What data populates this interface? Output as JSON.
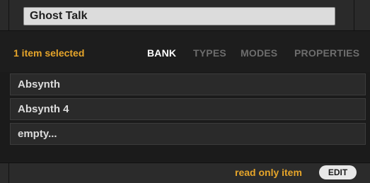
{
  "name_field": {
    "value": "Ghost Talk"
  },
  "selection": {
    "count_text": "1 item selected"
  },
  "tabs": [
    {
      "label": "BANK",
      "active": true
    },
    {
      "label": "TYPES",
      "active": false
    },
    {
      "label": "MODES",
      "active": false
    },
    {
      "label": "PROPERTIES",
      "active": false
    }
  ],
  "list": {
    "items": [
      {
        "label": "Absynth"
      },
      {
        "label": "Absynth 4"
      },
      {
        "label": "empty..."
      }
    ]
  },
  "footer": {
    "status_text": "read only item",
    "edit_label": "EDIT"
  },
  "colors": {
    "accent": "#e6a52a",
    "background": "#1b1b1b",
    "panel": "#2a2a2a"
  }
}
